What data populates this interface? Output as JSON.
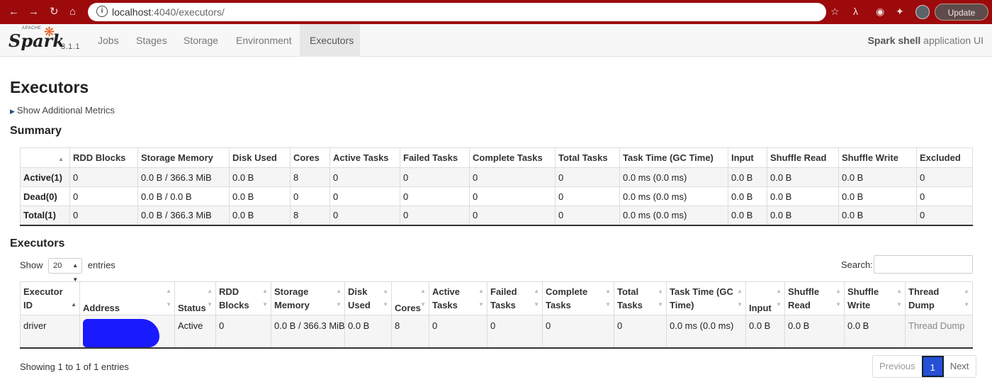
{
  "browser": {
    "url_host": "localhost",
    "url_rest": ":4040/executors/",
    "update_label": "Update"
  },
  "navbar": {
    "logo_apache": "APACHE",
    "logo_text": "Spark",
    "version": "3.1.1",
    "tabs": [
      "Jobs",
      "Stages",
      "Storage",
      "Environment",
      "Executors"
    ],
    "active_tab": "Executors",
    "app_name_bold": "Spark shell",
    "app_name_rest": " application UI"
  },
  "page_title": "Executors",
  "additional_metrics": "Show Additional Metrics",
  "summary": {
    "heading": "Summary",
    "columns": [
      "",
      "RDD Blocks",
      "Storage Memory",
      "Disk Used",
      "Cores",
      "Active Tasks",
      "Failed Tasks",
      "Complete Tasks",
      "Total Tasks",
      "Task Time (GC Time)",
      "Input",
      "Shuffle Read",
      "Shuffle Write",
      "Excluded"
    ],
    "rows": [
      [
        "Active(1)",
        "0",
        "0.0 B / 366.3 MiB",
        "0.0 B",
        "8",
        "0",
        "0",
        "0",
        "0",
        "0.0 ms (0.0 ms)",
        "0.0 B",
        "0.0 B",
        "0.0 B",
        "0"
      ],
      [
        "Dead(0)",
        "0",
        "0.0 B / 0.0 B",
        "0.0 B",
        "0",
        "0",
        "0",
        "0",
        "0",
        "0.0 ms (0.0 ms)",
        "0.0 B",
        "0.0 B",
        "0.0 B",
        "0"
      ],
      [
        "Total(1)",
        "0",
        "0.0 B / 366.3 MiB",
        "0.0 B",
        "8",
        "0",
        "0",
        "0",
        "0",
        "0.0 ms (0.0 ms)",
        "0.0 B",
        "0.0 B",
        "0.0 B",
        "0"
      ]
    ]
  },
  "executors": {
    "heading": "Executors",
    "show_label": "Show",
    "page_size": "20",
    "entries_label": "entries",
    "search_label": "Search:",
    "columns": [
      "Executor ID",
      "Address",
      "Status",
      "RDD Blocks",
      "Storage Memory",
      "Disk Used",
      "Cores",
      "Active Tasks",
      "Failed Tasks",
      "Complete Tasks",
      "Total Tasks",
      "Task Time (GC Time)",
      "Input",
      "Shuffle Read",
      "Shuffle Write",
      "Thread Dump"
    ],
    "rows": [
      [
        "driver",
        "",
        "Active",
        "0",
        "0.0 B / 366.3 MiB",
        "0.0 B",
        "8",
        "0",
        "0",
        "0",
        "0",
        "0.0 ms (0.0 ms)",
        "0.0 B",
        "0.0 B",
        "0.0 B",
        "Thread Dump"
      ]
    ],
    "showing_text": "Showing 1 to 1 of 1 entries",
    "pager": {
      "previous": "Previous",
      "current": "1",
      "next": "Next"
    }
  }
}
